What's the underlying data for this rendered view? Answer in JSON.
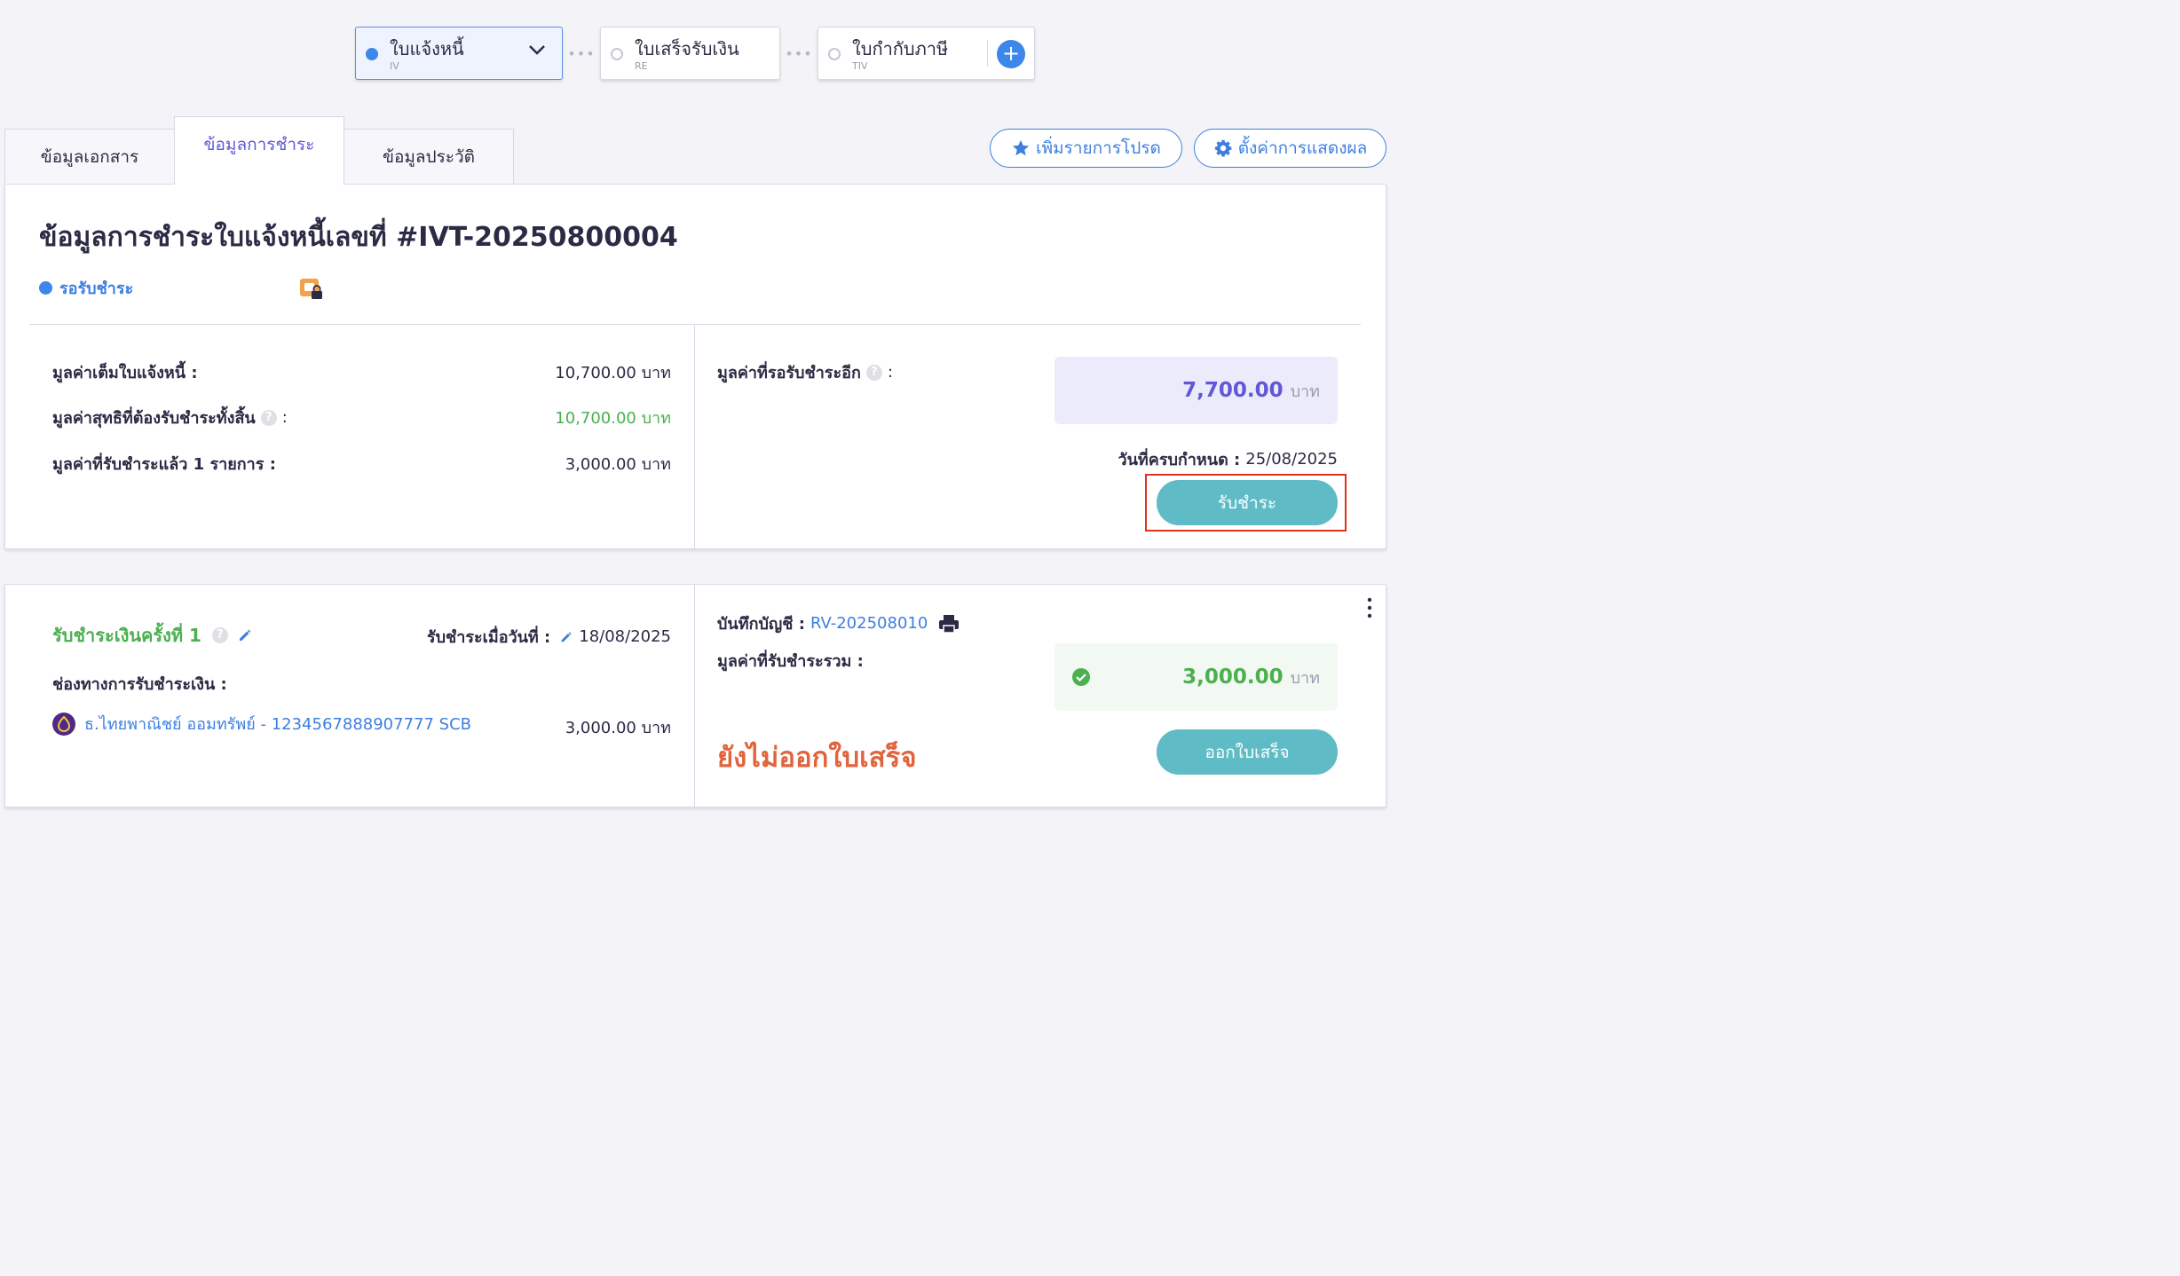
{
  "doc_chain": [
    {
      "name": "ใบแจ้งหนี้",
      "code": "IV"
    },
    {
      "name": "ใบเสร็จรับเงิน",
      "code": "RE"
    },
    {
      "name": "ใบกำกับภาษี",
      "code": "TIV"
    }
  ],
  "chain_separator": "•••",
  "add_symbol": "+",
  "tabs": [
    {
      "label": "ข้อมูลเอกสาร"
    },
    {
      "label": "ข้อมูลการชำระ"
    },
    {
      "label": "ข้อมูลประวัติ"
    }
  ],
  "actions": {
    "favorite": "เพิ่มรายการโปรด",
    "display_settings": "ตั้งค่าการแสดงผล"
  },
  "summary": {
    "title": "ข้อมูลการชำระใบแจ้งหนี้เลขที่ #IVT-20250800004",
    "status": "รอรับชำระ",
    "full_value_label": "มูลค่าเต็มใบแจ้งหนี้ :",
    "full_value": "10,700.00 บาท",
    "net_value_label": "มูลค่าสุทธิที่ต้องรับชำระทั้งสิ้น",
    "net_value": "10,700.00 บาท",
    "received_label": "มูลค่าที่รับชำระแล้ว 1 รายการ :",
    "received_value": "3,000.00 บาท",
    "remaining_label": "มูลค่าที่รอรับชำระอีก",
    "remaining_amount": "7,700.00",
    "unit": "บาท",
    "due_date_label": "วันที่ครบกำหนด :",
    "due_date": "25/08/2025",
    "receive_button": "รับชำระ"
  },
  "payment": {
    "title": "รับชำระเงินครั้งที่ 1",
    "date_label": "รับชำระเมื่อวันที่ :",
    "date": "18/08/2025",
    "channel_label": "ช่องทางการรับชำระเงิน :",
    "channel_name": "ธ.ไทยพาณิชย์ ออมทรัพย์ - 1234567888907777 SCB",
    "channel_amount": "3,000.00 บาท",
    "journal_label": "บันทึกบัญชี :",
    "journal_no": "RV-202508010",
    "total_label": "มูลค่าที่รับชำระรวม :",
    "total_amount": "3,000.00",
    "unit": "บาท",
    "receipt_status": "ยังไม่ออกใบเสร็จ",
    "issue_receipt_button": "ออกใบเสร็จ"
  },
  "colors": {
    "accent": "#3d7fe0",
    "tab_active": "#6058d6",
    "teal": "#5fbcc6",
    "green": "#4caf50",
    "warning": "#e2643c",
    "highlight": "#e0321f"
  }
}
